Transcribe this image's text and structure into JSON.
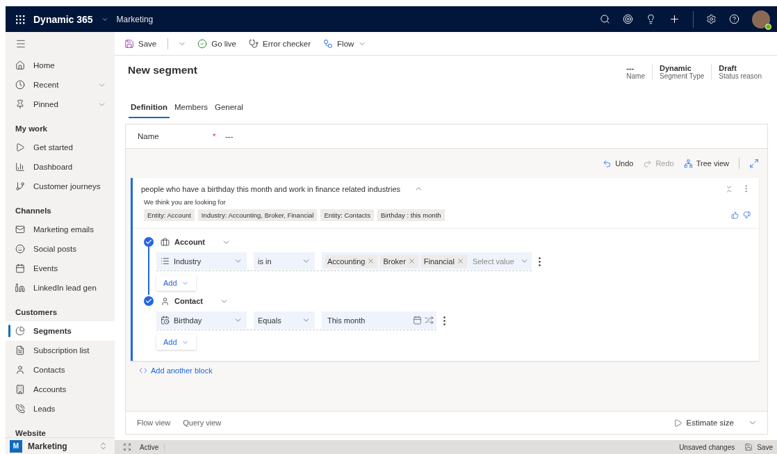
{
  "top_bar": {
    "app_name": "Dynamic 365",
    "area": "Marketing"
  },
  "command_bar": [
    {
      "label": "Save",
      "kind": "split"
    },
    {
      "label": "Go live",
      "kind": "button"
    },
    {
      "label": "Error checker",
      "kind": "button"
    },
    {
      "label": "Flow",
      "kind": "menu"
    }
  ],
  "sidebar": {
    "top_items": [
      {
        "label": "Home",
        "expandable": false
      },
      {
        "label": "Recent",
        "expandable": true
      },
      {
        "label": "Pinned",
        "expandable": true
      }
    ],
    "sections": [
      {
        "title": "My work",
        "items": [
          {
            "label": "Get started",
            "selected": false
          },
          {
            "label": "Dashboard",
            "selected": false
          },
          {
            "label": "Customer journeys",
            "selected": false
          }
        ]
      },
      {
        "title": "Channels",
        "items": [
          {
            "label": "Marketing emails",
            "selected": false
          },
          {
            "label": "Social posts",
            "selected": false
          },
          {
            "label": "Events",
            "selected": false
          },
          {
            "label": "LinkedIn lead gen",
            "selected": false
          }
        ]
      },
      {
        "title": "Customers",
        "items": [
          {
            "label": "Segments",
            "selected": true
          },
          {
            "label": "Subscription list",
            "selected": false
          },
          {
            "label": "Contacts",
            "selected": false
          },
          {
            "label": "Accounts",
            "selected": false
          },
          {
            "label": "Leads",
            "selected": false
          }
        ]
      },
      {
        "title": "Website"
      }
    ],
    "area_switcher": {
      "initial": "M",
      "label": "Marketing"
    }
  },
  "header": {
    "title": "New segment",
    "fields": [
      {
        "value": "---",
        "label": "Name"
      },
      {
        "value": "Dynamic",
        "label": "Segment Type"
      },
      {
        "value": "Draft",
        "label": "Status reason"
      }
    ]
  },
  "tabs": [
    {
      "label": "Definition",
      "selected": true
    },
    {
      "label": "Members",
      "selected": false
    },
    {
      "label": "General",
      "selected": false
    }
  ],
  "name_field": {
    "label": "Name",
    "required": true,
    "required_mark": "*",
    "value": "---"
  },
  "canvas_toolbar": [
    {
      "label": "Undo",
      "disabled": false
    },
    {
      "label": "Redo",
      "disabled": true
    },
    {
      "label": "Tree view",
      "disabled": false
    }
  ],
  "block": {
    "query": "people who have a birthday this month and work in finance related industries",
    "expanded": true,
    "suggestion_title": "We think you are looking for",
    "suggestions": [
      "Entity: Account",
      "Industry:  Accounting, Broker, Financial",
      "Entity: Contacts",
      "Birthday : this month"
    ],
    "groups": [
      {
        "entity": "Account",
        "kind": "account",
        "conditions": [
          {
            "kind": "multi",
            "attribute": "Industry",
            "operator": "is in",
            "values": [
              "Accounting",
              "Broker",
              "Financial"
            ],
            "placeholder": "Select value"
          }
        ],
        "add_label": "Add"
      },
      {
        "entity": "Contact",
        "kind": "contact",
        "conditions": [
          {
            "kind": "date",
            "attribute": "Birthday",
            "operator": "Equals",
            "value": "This month"
          }
        ],
        "add_label": "Add"
      }
    ]
  },
  "add_block": "Add another block",
  "footer": {
    "views": [
      "Flow view",
      "Query view"
    ],
    "estimate": "Estimate size"
  },
  "status_bar": {
    "state": "Active",
    "unsaved": "Unsaved changes",
    "save": "Save"
  }
}
